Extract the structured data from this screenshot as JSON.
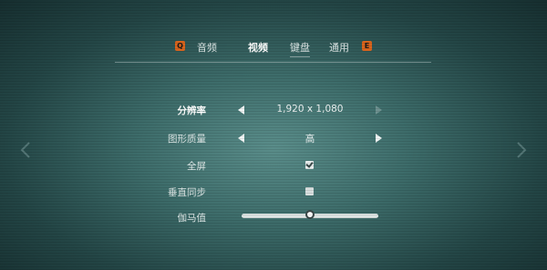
{
  "tabs": {
    "prev_key": "Q",
    "next_key": "E",
    "items": [
      {
        "label": "音频"
      },
      {
        "label": "视频"
      },
      {
        "label": "键盘"
      },
      {
        "label": "通用"
      }
    ]
  },
  "settings": {
    "resolution": {
      "label": "分辨率",
      "value": "1,920 x 1,080"
    },
    "graphics_quality": {
      "label": "图形质量",
      "value": "高"
    },
    "fullscreen": {
      "label": "全屏",
      "checked": true
    },
    "vsync": {
      "label": "垂直同步",
      "checked": false
    },
    "gamma": {
      "label": "伽马值",
      "level": 0.5
    }
  },
  "colors": {
    "accent": "#d9641d",
    "background": "#3d6c6a"
  },
  "icons": {
    "page_prev": "chevron-left-icon",
    "page_next": "chevron-right-icon"
  }
}
